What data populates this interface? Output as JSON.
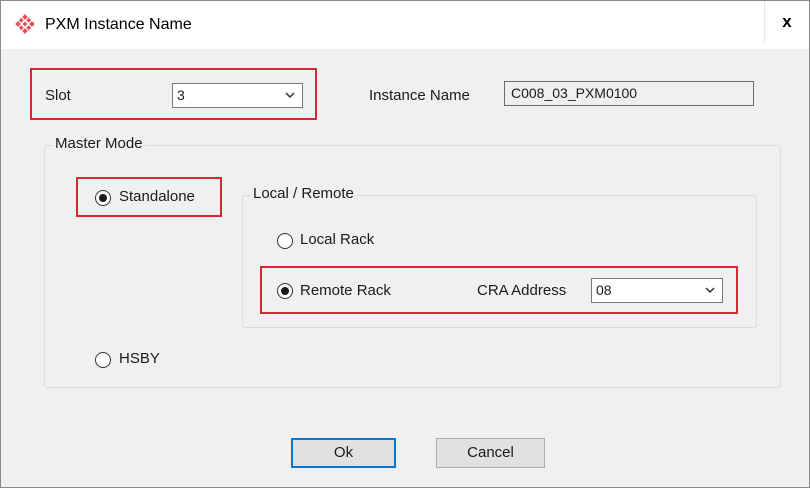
{
  "window": {
    "title": "PXM Instance Name",
    "close_label": "x"
  },
  "slot": {
    "label": "Slot",
    "value": "3"
  },
  "instance_name": {
    "label": "Instance Name",
    "value": "C008_03_PXM0100"
  },
  "master_mode": {
    "title": "Master Mode",
    "standalone": {
      "label": "Standalone",
      "checked": true
    },
    "hsby": {
      "label": "HSBY",
      "checked": false
    }
  },
  "local_remote": {
    "title": "Local / Remote",
    "local_rack": {
      "label": "Local Rack",
      "checked": false
    },
    "remote_rack": {
      "label": "Remote Rack",
      "checked": true
    }
  },
  "cra_address": {
    "label": "CRA Address",
    "value": "08"
  },
  "buttons": {
    "ok": "Ok",
    "cancel": "Cancel"
  },
  "colors": {
    "highlight": "#d7262e",
    "default_button_border": "#0078d7",
    "icon": "#e0505a"
  }
}
